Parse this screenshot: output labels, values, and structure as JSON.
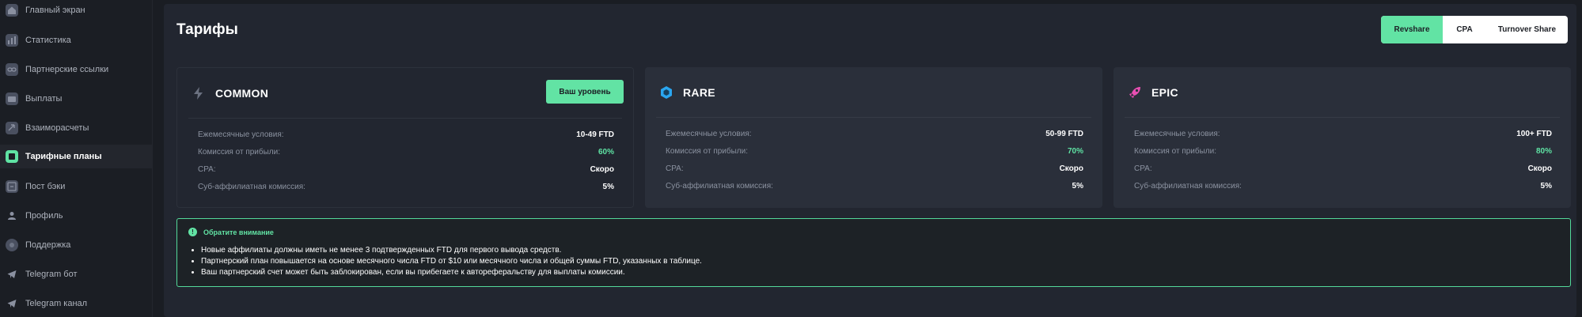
{
  "sidebar": {
    "items": [
      {
        "label": "Главный экран",
        "icon": "home-icon"
      },
      {
        "label": "Статистика",
        "icon": "chart-icon"
      },
      {
        "label": "Партнерские ссылки",
        "icon": "link-icon"
      },
      {
        "label": "Выплаты",
        "icon": "wallet-icon"
      },
      {
        "label": "Взаиморасчеты",
        "icon": "exchange-icon"
      },
      {
        "label": "Тарифные планы",
        "icon": "plans-icon",
        "active": true
      },
      {
        "label": "Пост бэки",
        "icon": "postback-icon"
      },
      {
        "label": "Профиль",
        "icon": "user-icon"
      },
      {
        "label": "Поддержка",
        "icon": "support-icon"
      },
      {
        "label": "Telegram бот",
        "icon": "telegram-icon"
      },
      {
        "label": "Telegram канал",
        "icon": "telegram-icon"
      }
    ]
  },
  "header": {
    "title": "Тарифы",
    "tabs": [
      {
        "label": "Revshare",
        "active": true
      },
      {
        "label": "CPA"
      },
      {
        "label": "Turnover Share"
      }
    ]
  },
  "labels": {
    "monthly": "Ежемесячные условия:",
    "commission": "Комиссия от прибыли:",
    "cpa": "CPA:",
    "sub": "Суб-аффилиатная комиссия:"
  },
  "tiers": [
    {
      "name": "COMMON",
      "icon": "bolt-icon",
      "icon_color": "#6b7180",
      "current": true,
      "level_label": "Ваш уровень",
      "monthly": "10-49 FTD",
      "commission": "60%",
      "cpa": "Скоро",
      "sub": "5%"
    },
    {
      "name": "RARE",
      "icon": "gem-icon",
      "icon_color": "#2aa6f0",
      "monthly": "50-99 FTD",
      "commission": "70%",
      "cpa": "Скоро",
      "sub": "5%"
    },
    {
      "name": "EPIC",
      "icon": "rocket-icon",
      "icon_color": "#e94fb3",
      "monthly": "100+ FTD",
      "commission": "80%",
      "cpa": "Скоро",
      "sub": "5%"
    }
  ],
  "notice": {
    "title": "Обратите внимание",
    "items": [
      "Новые аффилиаты должны иметь не менее 3 подтвержденных FTD для первого вывода средств.",
      "Партнерский план повышается на основе месячного числа FTD от $10 или месячного числа и общей суммы FTD, указанных в таблице.",
      "Ваш партнерский счет может быть заблокирован, если вы прибегаете к автореферальству для выплаты комиссии."
    ]
  },
  "colors": {
    "accent": "#62e3a4",
    "panel": "#222630",
    "card": "#2a2f3a"
  }
}
